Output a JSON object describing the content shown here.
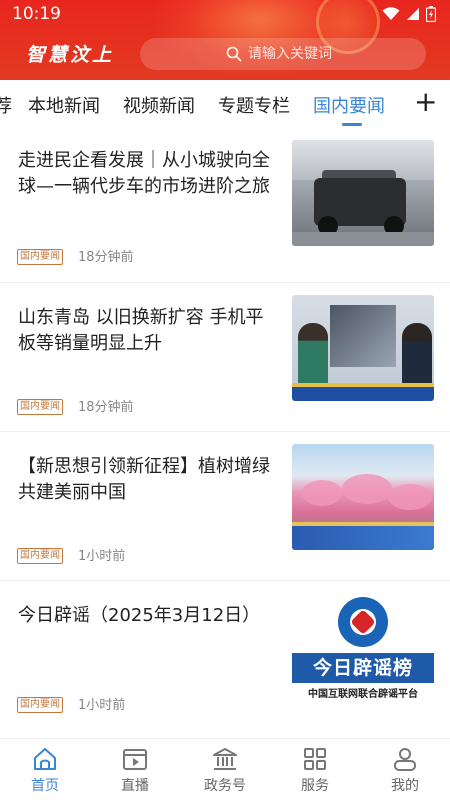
{
  "status_bar": {
    "time": "10:19"
  },
  "header": {
    "brand": "智慧汶上",
    "search_placeholder": "请输入关键词",
    "brand_color": "#e5321f"
  },
  "tabs": {
    "items": [
      {
        "label": "荐",
        "active": false
      },
      {
        "label": "本地新闻",
        "active": false
      },
      {
        "label": "视频新闻",
        "active": false
      },
      {
        "label": "专题专栏",
        "active": false
      },
      {
        "label": "国内要闻",
        "active": true
      }
    ],
    "add_label": "+",
    "active_color": "#3a86d6"
  },
  "feed": [
    {
      "title": "走进民企看发展｜从小城驶向全球—一辆代步车的市场进阶之旅",
      "tag": "国内要闻",
      "time": "18分钟前"
    },
    {
      "title": "山东青岛  以旧换新扩容  手机平板等销量明显上升",
      "tag": "国内要闻",
      "time": "18分钟前"
    },
    {
      "title": "【新思想引领新征程】植树增绿共建美丽中国",
      "tag": "国内要闻",
      "time": "1小时前"
    },
    {
      "title": "今日辟谣（2025年3月12日）",
      "tag": "国内要闻",
      "time": "1小时前",
      "thumb_banner": "今日辟谣榜",
      "thumb_sub": "中国互联网联合辟谣平台"
    }
  ],
  "bottom_nav": [
    {
      "label": "首页",
      "icon": "home-icon",
      "active": true
    },
    {
      "label": "直播",
      "icon": "live-icon",
      "active": false
    },
    {
      "label": "政务号",
      "icon": "government-icon",
      "active": false
    },
    {
      "label": "服务",
      "icon": "services-grid-icon",
      "active": false
    },
    {
      "label": "我的",
      "icon": "profile-icon",
      "active": false
    }
  ]
}
